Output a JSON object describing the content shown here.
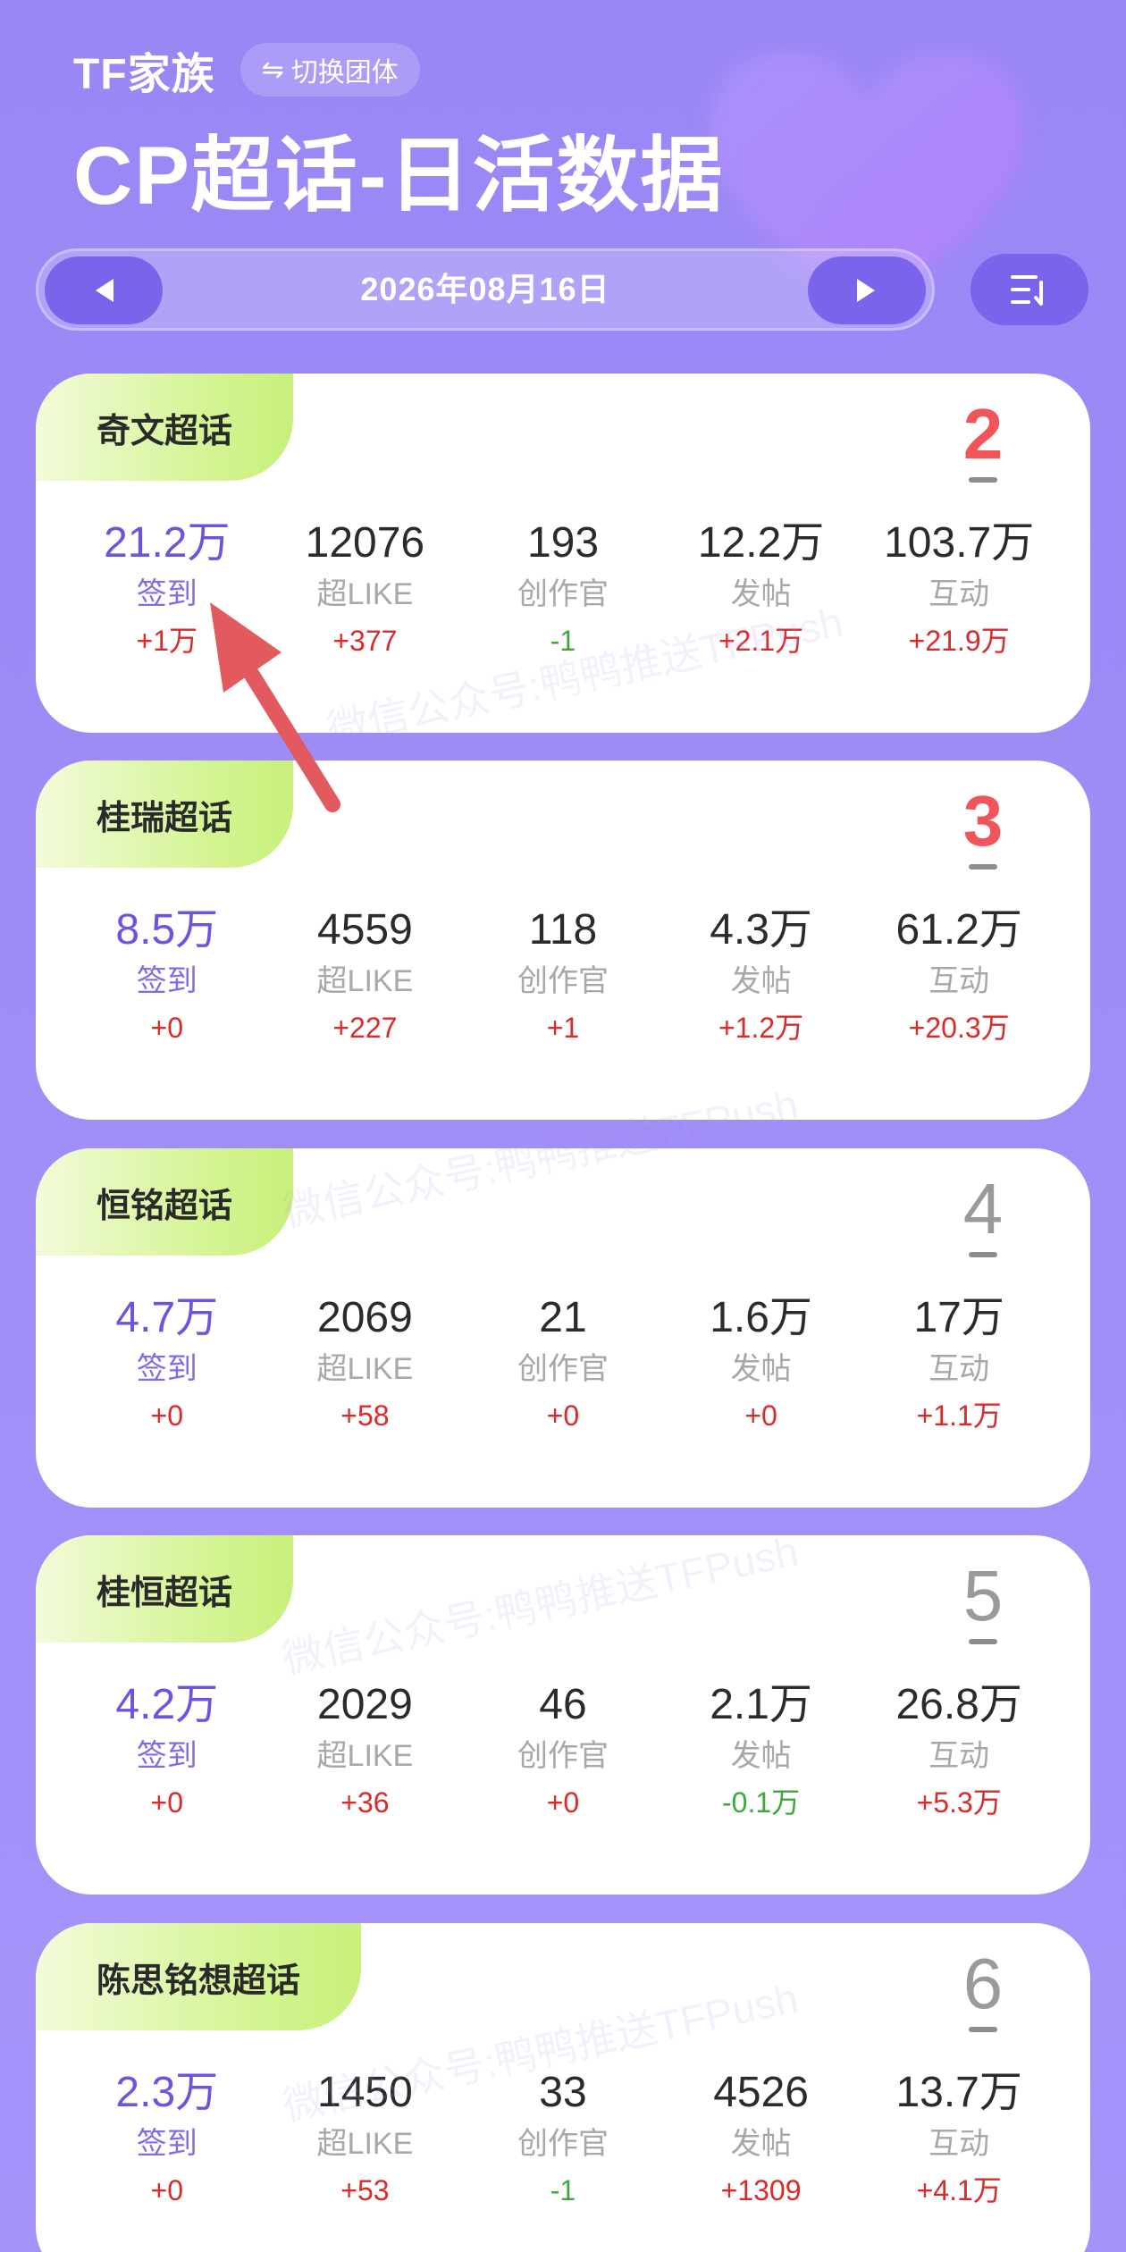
{
  "header": {
    "family": "TF家族",
    "switch_label": "切换团体",
    "title": "CP超话-日活数据"
  },
  "date_bar": {
    "date": "2026年08月16日"
  },
  "watermark": "微信公众号:鸭鸭推送TFPush",
  "colors": {
    "accent": "#7b63ec",
    "rank_top": "#f0555a",
    "increase": "#dc2a2a",
    "decrease": "#3aa83a"
  },
  "cards": [
    {
      "name": "奇文超话",
      "rank": "2",
      "stats": [
        {
          "value": "21.2万",
          "label": "签到",
          "change": "+1万"
        },
        {
          "value": "12076",
          "label": "超LIKE",
          "change": "+377"
        },
        {
          "value": "193",
          "label": "创作官",
          "change": "-1"
        },
        {
          "value": "12.2万",
          "label": "发帖",
          "change": "+2.1万"
        },
        {
          "value": "103.7万",
          "label": "互动",
          "change": "+21.9万"
        }
      ]
    },
    {
      "name": "桂瑞超话",
      "rank": "3",
      "stats": [
        {
          "value": "8.5万",
          "label": "签到",
          "change": "+0"
        },
        {
          "value": "4559",
          "label": "超LIKE",
          "change": "+227"
        },
        {
          "value": "118",
          "label": "创作官",
          "change": "+1"
        },
        {
          "value": "4.3万",
          "label": "发帖",
          "change": "+1.2万"
        },
        {
          "value": "61.2万",
          "label": "互动",
          "change": "+20.3万"
        }
      ]
    },
    {
      "name": "恒铭超话",
      "rank": "4",
      "stats": [
        {
          "value": "4.7万",
          "label": "签到",
          "change": "+0"
        },
        {
          "value": "2069",
          "label": "超LIKE",
          "change": "+58"
        },
        {
          "value": "21",
          "label": "创作官",
          "change": "+0"
        },
        {
          "value": "1.6万",
          "label": "发帖",
          "change": "+0"
        },
        {
          "value": "17万",
          "label": "互动",
          "change": "+1.1万"
        }
      ]
    },
    {
      "name": "桂恒超话",
      "rank": "5",
      "stats": [
        {
          "value": "4.2万",
          "label": "签到",
          "change": "+0"
        },
        {
          "value": "2029",
          "label": "超LIKE",
          "change": "+36"
        },
        {
          "value": "46",
          "label": "创作官",
          "change": "+0"
        },
        {
          "value": "2.1万",
          "label": "发帖",
          "change": "-0.1万"
        },
        {
          "value": "26.8万",
          "label": "互动",
          "change": "+5.3万"
        }
      ]
    },
    {
      "name": "陈思铭想超话",
      "rank": "6",
      "stats": [
        {
          "value": "2.3万",
          "label": "签到",
          "change": "+0"
        },
        {
          "value": "1450",
          "label": "超LIKE",
          "change": "+53"
        },
        {
          "value": "33",
          "label": "创作官",
          "change": "-1"
        },
        {
          "value": "4526",
          "label": "发帖",
          "change": "+1309"
        },
        {
          "value": "13.7万",
          "label": "互动",
          "change": "+4.1万"
        }
      ]
    }
  ]
}
